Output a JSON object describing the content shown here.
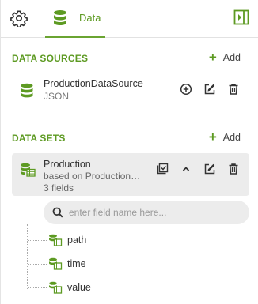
{
  "tabs": {
    "settings_icon": "gear-icon",
    "data_label": "Data"
  },
  "colors": {
    "accent": "#5d9a22",
    "card_bg": "#ececec"
  },
  "data_sources": {
    "title": "DATA SOURCES",
    "add_label": "Add",
    "items": [
      {
        "name": "ProductionDataSource",
        "type": "JSON"
      }
    ]
  },
  "data_sets": {
    "title": "DATA SETS",
    "add_label": "Add",
    "items": [
      {
        "name": "Production",
        "description": "based on ProductionDataSource",
        "field_count": "3 fields"
      }
    ]
  },
  "field_search": {
    "placeholder": "enter field name here..."
  },
  "fields": [
    {
      "label": "path"
    },
    {
      "label": "time"
    },
    {
      "label": "value"
    }
  ]
}
